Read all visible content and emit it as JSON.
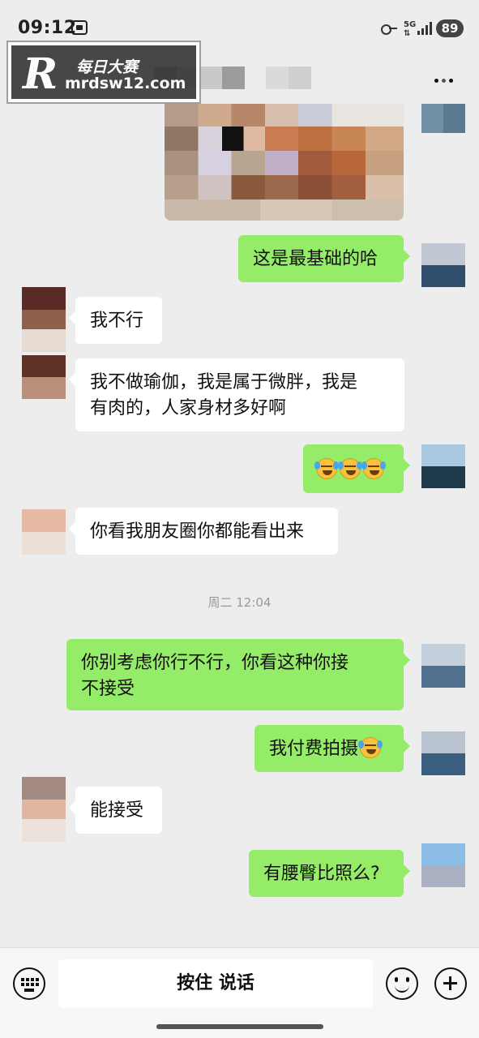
{
  "status_bar": {
    "time": "09:12",
    "network": "5G",
    "battery": "89",
    "icons": [
      "screen-record-icon",
      "key-icon",
      "signal-icon"
    ]
  },
  "watermark": {
    "logo": "R",
    "title": "每日大赛",
    "domain": "mrdsw12.com"
  },
  "header": {
    "back_icon": "back-chevron-icon",
    "more_icon": "more-dots-icon"
  },
  "messages": [
    {
      "side": "right",
      "type": "image",
      "note": "pixelated photo"
    },
    {
      "side": "right",
      "type": "text",
      "text": "这是最基础的哈"
    },
    {
      "side": "left",
      "type": "text",
      "text": "我不行"
    },
    {
      "side": "left",
      "type": "text",
      "lines": [
        "我不做瑜伽，我是属于微胖，我是",
        "有肉的，人家身材多好啊"
      ]
    },
    {
      "side": "right",
      "type": "emoji",
      "emoji_count": 3,
      "emoji_name": "laugh-cry-emoji"
    },
    {
      "side": "left",
      "type": "text",
      "text": "你看我朋友圈你都能看出来"
    },
    {
      "side": "right",
      "type": "text",
      "lines": [
        "你别考虑你行不行，你看这种你接",
        "不接受"
      ]
    },
    {
      "side": "right",
      "type": "text",
      "text": "我付费拍摄"
    },
    {
      "side": "left",
      "type": "text",
      "text": "能接受"
    },
    {
      "side": "right",
      "type": "text",
      "text": "有腰臀比照么?"
    }
  ],
  "time_divider": "周二 12:04",
  "input_bar": {
    "hold_to_talk": "按住 说话",
    "left_icon": "keyboard-icon",
    "emoji_icon": "smiley-icon",
    "plus_icon": "plus-icon"
  },
  "colors": {
    "background": "#ededed",
    "bubble_self": "#95ec69",
    "bubble_other": "#ffffff",
    "input_bar": "#f7f7f7"
  }
}
